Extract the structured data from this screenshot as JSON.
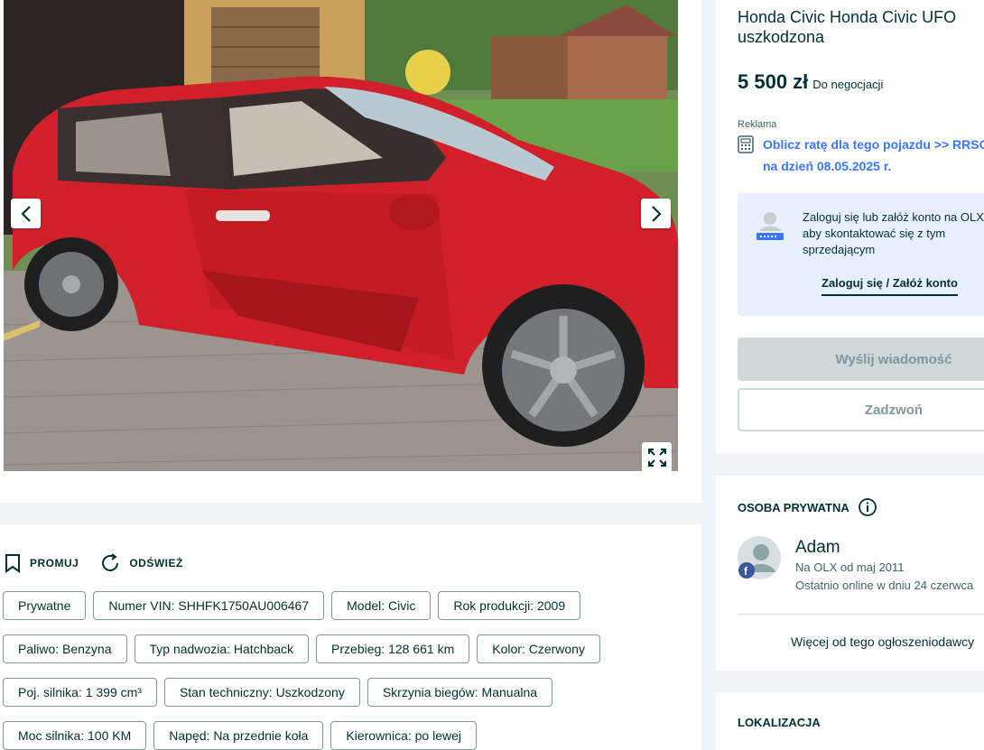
{
  "listing": {
    "title": "Honda Civic Honda Civic UFO uszkodzona",
    "price": "5 500 zł",
    "negotiable": "Do negocjacji",
    "ad_label": "Reklama",
    "loan_line1": "Oblicz ratę dla tego pojazdu >> RRSO",
    "loan_line2": "na dzień 08.05.2025 r."
  },
  "login_box": {
    "text": "Zaloguj się lub załóż konto na OLX, aby skontaktować się z tym sprzedającym",
    "link": "Zaloguj się / Załóż konto"
  },
  "buttons": {
    "message": "Wyślij wiadomość",
    "call": "Zadzwoń"
  },
  "seller": {
    "type": "OSOBA PRYWATNA",
    "name": "Adam",
    "since": "Na OLX od maj 2011",
    "online": "Ostatnio online w dniu 24 czerwca",
    "more_ads": "Więcej od tego ogłoszeniodawcy"
  },
  "location": {
    "title": "LOKALIZACJA"
  },
  "actions": {
    "promote": "PROMUJ",
    "refresh": "ODŚWIEŻ"
  },
  "tags": [
    [
      "Prywatne",
      "Numer VIN: SHHFK1750AU006467",
      "Model: Civic",
      "Rok produkcji: 2009"
    ],
    [
      "Paliwo: Benzyna",
      "Typ nadwozia: Hatchback",
      "Przebieg: 128 661 km",
      "Kolor: Czerwony"
    ],
    [
      "Poj. silnika: 1 399 cm³",
      "Stan techniczny: Uszkodzony",
      "Skrzynia biegów: Manualna"
    ],
    [
      "Moc silnika: 100 KM",
      "Napęd: Na przednie koła",
      "Kierownica: po lewej"
    ]
  ],
  "icons": {
    "prev": "chevron-left-icon",
    "next": "chevron-right-icon",
    "expand": "expand-icon",
    "promote": "bookmark-icon",
    "refresh": "refresh-icon",
    "calculator": "calculator-icon",
    "info": "info-icon",
    "facebook": "facebook-icon"
  },
  "colors": {
    "primary_text": "#002f34",
    "link_blue": "#3a77ff",
    "login_bg": "#e8f0ff",
    "disabled_btn": "#cfd7d8",
    "car_red": "#d2202a"
  }
}
